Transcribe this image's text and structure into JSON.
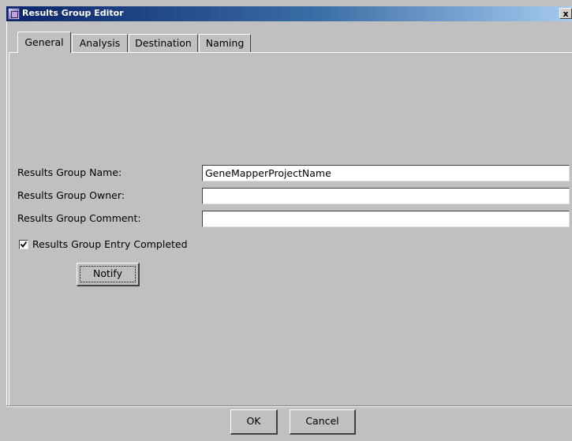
{
  "window": {
    "title": "Results Group Editor",
    "close_glyph": "x"
  },
  "tabs": [
    {
      "label": "General",
      "active": true
    },
    {
      "label": "Analysis",
      "active": false
    },
    {
      "label": "Destination",
      "active": false
    },
    {
      "label": "Naming",
      "active": false
    }
  ],
  "form": {
    "name_label": "Results Group Name:",
    "name_value": "GeneMapperProjectName",
    "owner_label": "Results Group Owner:",
    "owner_value": "",
    "comment_label": "Results Group Comment:",
    "comment_value": "",
    "entry_completed_label": "Results Group Entry Completed",
    "entry_completed_checked": true,
    "notify_label": "Notify"
  },
  "footer": {
    "ok_label": "OK",
    "cancel_label": "Cancel"
  },
  "icons": {
    "app": "app-icon",
    "close": "close-icon",
    "check": "checkmark-icon"
  }
}
